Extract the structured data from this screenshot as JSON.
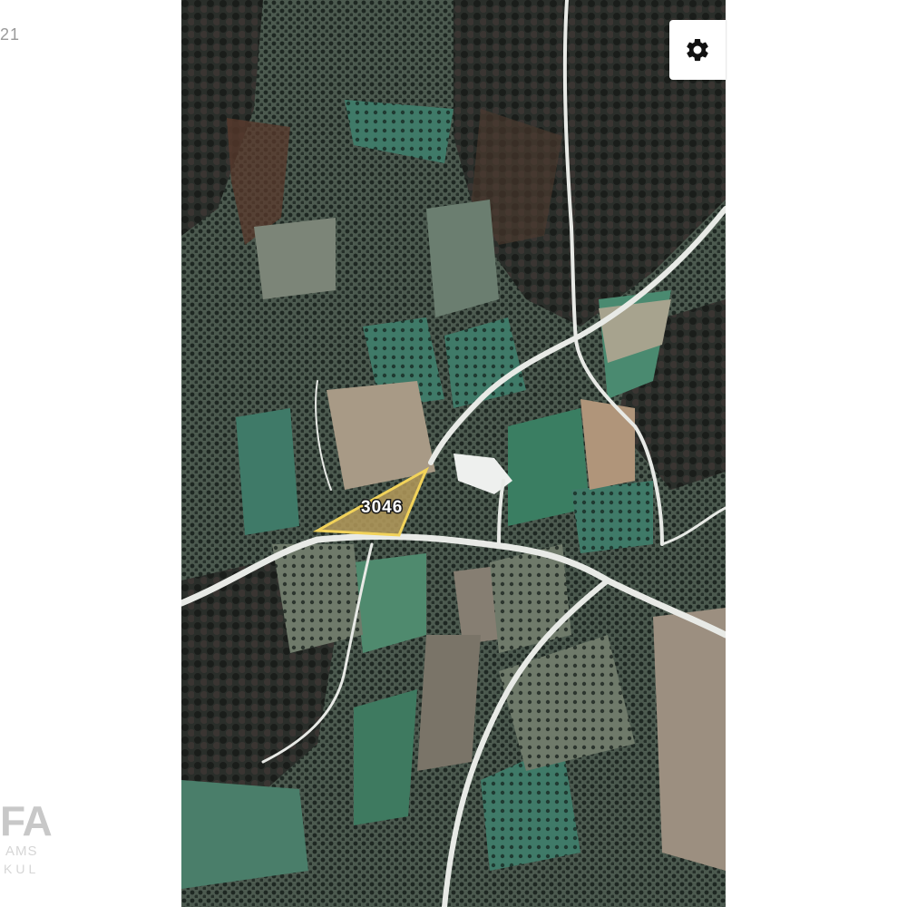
{
  "corner_text": "21",
  "watermark": {
    "main": "FA",
    "line1": "AMS",
    "line2": "KUL"
  },
  "map": {
    "parcel": {
      "label": "3046",
      "outline_color": "#f2d35a",
      "fill_color": "#b49a5a"
    },
    "road_color": "#e8eae6"
  },
  "controls": {
    "settings_icon": "gear-icon"
  }
}
